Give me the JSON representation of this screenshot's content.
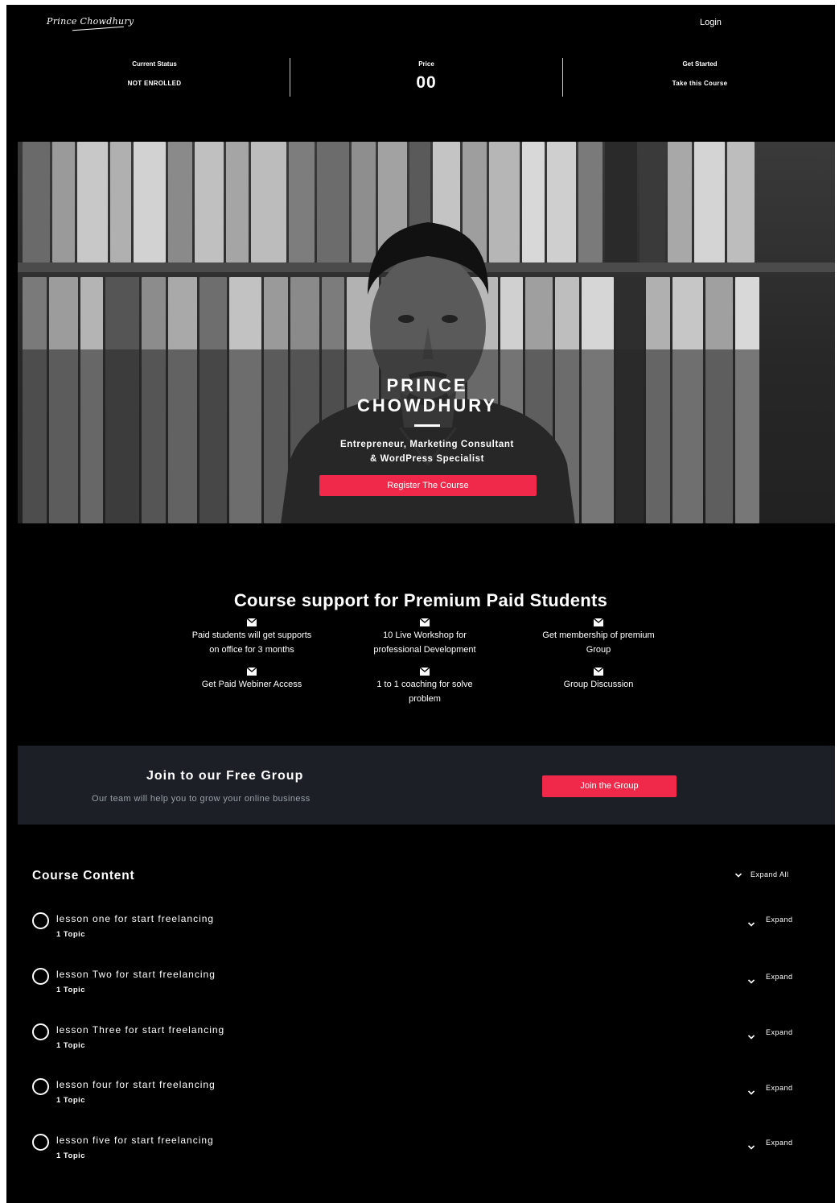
{
  "header": {
    "logo_text": "Prince Chowdhury",
    "login_label": "Login"
  },
  "status": {
    "current_status_label": "Current Status",
    "current_status_value": "NOT ENROLLED",
    "price_label": "Price",
    "price_value": "00",
    "get_started_label": "Get Started",
    "get_started_value": "Take this Course"
  },
  "hero": {
    "name_line1": "PRINCE",
    "name_line2": "CHOWDHURY",
    "subtitle_line1": "Entrepreneur, Marketing Consultant",
    "subtitle_line2": "& WordPress Specialist",
    "button_label": "Register The Course"
  },
  "support": {
    "title": "Course support for Premium Paid Students",
    "features": [
      {
        "line1": "Paid students will get supports",
        "line2": "on office for 3 months",
        "icon": "mail-icon"
      },
      {
        "line1": "10 Live Workshop for",
        "line2": "professional Development",
        "icon": "mail-icon"
      },
      {
        "line1": "Get membership of premium",
        "line2": "Group",
        "icon": "mail-icon"
      },
      {
        "line1": "Get Paid Webiner Access",
        "line2": "",
        "icon": "mail-icon"
      },
      {
        "line1": "1 to 1 coaching for solve",
        "line2": "problem",
        "icon": "mail-icon"
      },
      {
        "line1": "Group Discussion",
        "line2": "",
        "icon": "mail-icon"
      }
    ]
  },
  "join": {
    "title": "Join to our Free Group",
    "subtitle": "Our team will help you to grow your online business",
    "button_label": "Join the Group"
  },
  "course_content": {
    "title": "Course Content",
    "expand_all_label": "Expand All",
    "lessons": [
      {
        "name": "lesson one for start freelancing",
        "topics": "1 Topic",
        "expand_label": "Expand"
      },
      {
        "name": "lesson Two for start freelancing",
        "topics": "1 Topic",
        "expand_label": "Expand"
      },
      {
        "name": "lesson Three for start freelancing",
        "topics": "1 Topic",
        "expand_label": "Expand"
      },
      {
        "name": "lesson four for start freelancing",
        "topics": "1 Topic",
        "expand_label": "Expand"
      },
      {
        "name": "lesson five for start freelancing",
        "topics": "1 Topic",
        "expand_label": "Expand"
      }
    ]
  },
  "colors": {
    "accent": "#f0284a",
    "background": "#000000",
    "join_panel": "#1c1f26"
  }
}
